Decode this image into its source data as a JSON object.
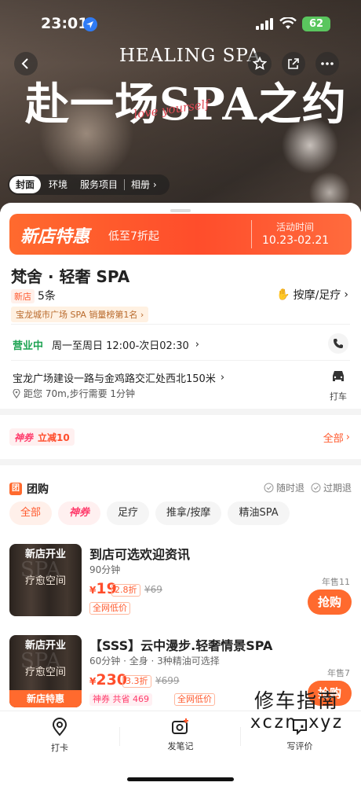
{
  "status_bar": {
    "time": "23:01",
    "battery": "62"
  },
  "hero": {
    "title_en": "HEALING SPA",
    "title_cn": "赴一场SPA之约",
    "script_text": "love yourself",
    "tabs": [
      "封面",
      "环境",
      "服务项目",
      "相册"
    ]
  },
  "promo": {
    "title": "新店特惠",
    "subtitle": "低至7折起",
    "date_label": "活动时间",
    "date_range": "10.23-02.21"
  },
  "shop": {
    "name": "梵舍 · 轻奢 SPA",
    "new_tag": "新店",
    "reviews": "5条",
    "category": "按摩/足疗",
    "rank": "宝龙城市广场 SPA 销量榜第1名",
    "open_status": "营业中",
    "hours": "周一至周日 12:00-次日02:30",
    "address": "宝龙广场建设一路与金鸡路交汇处西北150米",
    "distance": "距您 70m,步行需要 1分钟",
    "taxi_label": "打车"
  },
  "coupon": {
    "brand": "神券",
    "text": "立减10",
    "all_label": "全部"
  },
  "group_buy": {
    "title": "团购",
    "policy_1": "随时退",
    "policy_2": "过期退",
    "filters": [
      "全部",
      "神券",
      "足疗",
      "推拿/按摩",
      "精油SPA"
    ],
    "deals": [
      {
        "thumb_top": "新店开业",
        "thumb_mid": "疗愈空间",
        "thumb_bg": "SPA",
        "title": "到店可选欢迎资讯",
        "sub": "90分钟",
        "price": "19",
        "discount": "2.8折",
        "original": "¥69",
        "tag": "全网低价",
        "sold": "年售11",
        "button": "抢购"
      },
      {
        "thumb_top": "新店开业",
        "thumb_mid": "疗愈空间",
        "thumb_bg": "SPA",
        "thumb_foot": "新店特惠",
        "title": "【SSS】云中漫步.轻奢情景SPA",
        "sub": "60分钟 · 全身 · 3种精油可选择",
        "price": "230",
        "discount": "3.3折",
        "original": "¥699",
        "save": "神券 共省 469",
        "tag": "全网低价",
        "sold": "年售7",
        "button": "抢购"
      }
    ]
  },
  "bottom_bar": {
    "items": [
      "打卡",
      "发笔记",
      "写评价"
    ]
  },
  "watermark": {
    "cn": "修车指南",
    "en": "xczn.xyz"
  },
  "colors": {
    "accent": "#ff5a2e",
    "open_green": "#1ea352",
    "brand_pink": "#ff3b6b"
  }
}
